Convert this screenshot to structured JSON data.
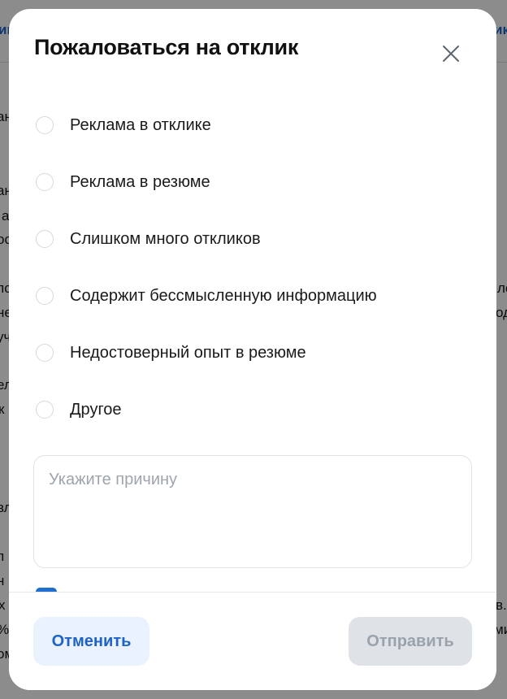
{
  "background": {
    "fragments": [
      "ик",
      "ик",
      "ан",
      "ан",
      "а",
      "ос",
      "пс",
      "не",
      "уч",
      "ел",
      "к",
      "вл",
      "п",
      "н",
      "х",
      "%",
      "ом",
      "ле",
      "од",
      "в.",
      "ми"
    ]
  },
  "modal": {
    "title": "Пожаловаться на отклик",
    "close_icon": "close-icon",
    "options": [
      {
        "label": "Реклама в отклике",
        "selected": false
      },
      {
        "label": "Реклама в резюме",
        "selected": false
      },
      {
        "label": "Слишком много откликов",
        "selected": false
      },
      {
        "label": "Содержит бессмысленную информацию",
        "selected": false
      },
      {
        "label": "Недостоверный опыт в резюме",
        "selected": false
      },
      {
        "label": "Другое",
        "selected": false
      }
    ],
    "reason": {
      "placeholder": "Укажите причину",
      "value": ""
    },
    "checkbox": {
      "checked": true,
      "color": "#1f6fd1"
    },
    "footer": {
      "cancel_label": "Отменить",
      "submit_label": "Отправить",
      "submit_disabled": true
    }
  },
  "colors": {
    "accent": "#1f63c4",
    "cancel_bg": "#e9f2fd",
    "disabled_bg": "#dfe3e8"
  }
}
